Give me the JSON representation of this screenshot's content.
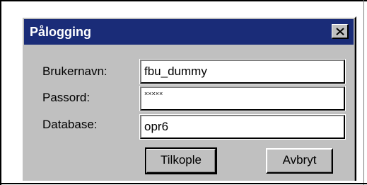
{
  "dialog": {
    "title": "Pålogging",
    "close_icon": "close-x-icon"
  },
  "fields": {
    "username": {
      "label": "Brukernavn:",
      "value": "fbu_dummy"
    },
    "password": {
      "label": "Passord:",
      "value": "×××××"
    },
    "database": {
      "label": "Database:",
      "value": "opr6"
    }
  },
  "buttons": {
    "connect_label": "Tilkople",
    "cancel_label": "Avbryt"
  },
  "colors": {
    "titlebar": "#1a2c78",
    "dialog_face": "#c0c0c0",
    "input_bg": "#ffffff"
  }
}
